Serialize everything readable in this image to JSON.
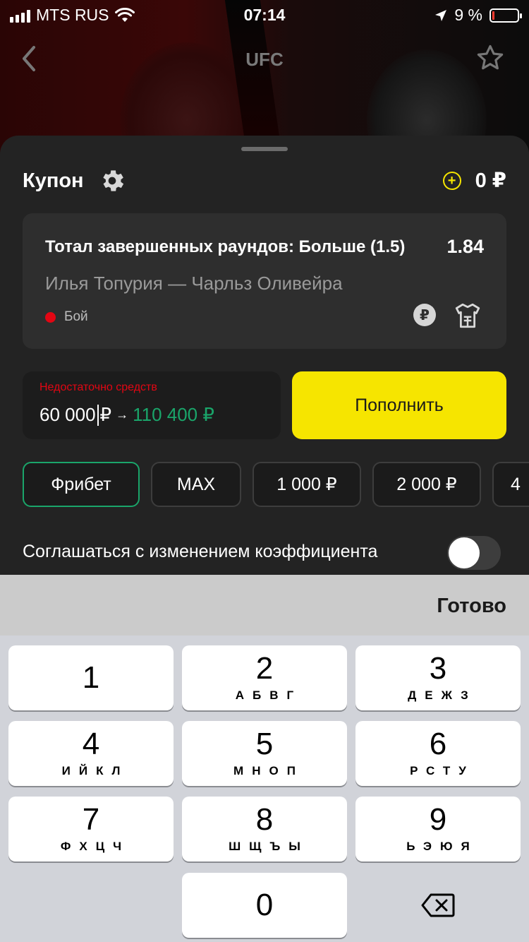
{
  "status_bar": {
    "carrier": "MTS RUS",
    "time": "07:14",
    "battery_percent": "9 %",
    "battery_level": 0.09
  },
  "nav": {
    "title": "UFC",
    "back_icon": "chevron-left-icon",
    "favorite_icon": "star-icon"
  },
  "coupon": {
    "title": "Купон",
    "settings_icon": "gear-icon",
    "balance": "0 ₽",
    "bet": {
      "market": "Тотал завершенных раундов: Больше (1.5)",
      "odds": "1.84",
      "event": "Илья Топурия — Чарльз Оливейра",
      "status": "Бой",
      "badge": "₽"
    },
    "stake": {
      "error": "Недостаточно средств",
      "value": "60 000",
      "currency": "₽",
      "arrow": "→",
      "potential_win": "110 400 ₽"
    },
    "topup_label": "Пополнить",
    "quick_amounts": [
      "Фрибет",
      "MAX",
      "1 000 ₽",
      "2 000 ₽",
      "4"
    ],
    "accept_changes": {
      "label": "Соглашаться с изменением коэффициента",
      "enabled": false
    }
  },
  "keyboard": {
    "done_label": "Готово",
    "keys": [
      {
        "digit": "1",
        "letters": ""
      },
      {
        "digit": "2",
        "letters": "АБВГ"
      },
      {
        "digit": "3",
        "letters": "ДЕЖЗ"
      },
      {
        "digit": "4",
        "letters": "ИЙКЛ"
      },
      {
        "digit": "5",
        "letters": "МНОП"
      },
      {
        "digit": "6",
        "letters": "РСТУ"
      },
      {
        "digit": "7",
        "letters": "ФХЦЧ"
      },
      {
        "digit": "8",
        "letters": "ШЩЪЫ"
      },
      {
        "digit": "9",
        "letters": "ЬЭЮЯ"
      },
      {
        "digit": "0",
        "letters": ""
      }
    ]
  },
  "colors": {
    "accent_yellow": "#f6e500",
    "accent_green": "#1aa56a",
    "error_red": "#e30613",
    "sheet_bg": "#232323"
  }
}
